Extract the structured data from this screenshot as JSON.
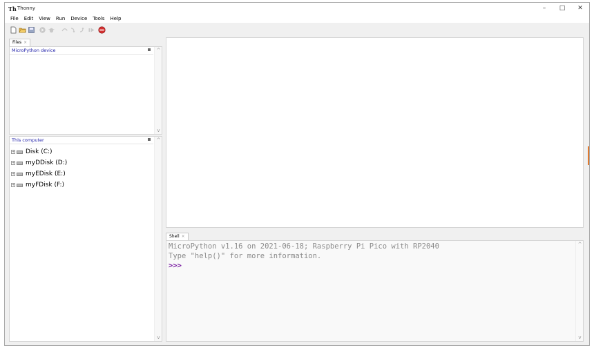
{
  "window": {
    "title": "Thonny",
    "app_icon": "Th",
    "controls": {
      "minimize": "–",
      "maximize": "□",
      "close": "✕"
    }
  },
  "menubar": [
    "File",
    "Edit",
    "View",
    "Run",
    "Device",
    "Tools",
    "Help"
  ],
  "toolbar": {
    "icons": [
      "new-file-icon",
      "open-file-icon",
      "save-icon",
      "run-icon",
      "debug-icon",
      "step-over-icon",
      "step-into-icon",
      "step-out-icon",
      "resume-icon",
      "stop-icon"
    ]
  },
  "files": {
    "tab_label": "Files",
    "device_header": "MicroPython device",
    "computer_header": "This computer",
    "drives": [
      "Disk (C:)",
      "myDDisk (D:)",
      "myEDisk (E:)",
      "myFDisk (F:)"
    ]
  },
  "shell": {
    "tab_label": "Shell",
    "lines": [
      "MicroPython v1.16 on 2021-06-18; Raspberry Pi Pico with RP2040",
      "Type \"help()\" for more information."
    ],
    "prompt": ">>>"
  },
  "colors": {
    "accent": "#1a1aa6",
    "prompt": "#7a1fa2",
    "stop": "#d32f2f"
  }
}
